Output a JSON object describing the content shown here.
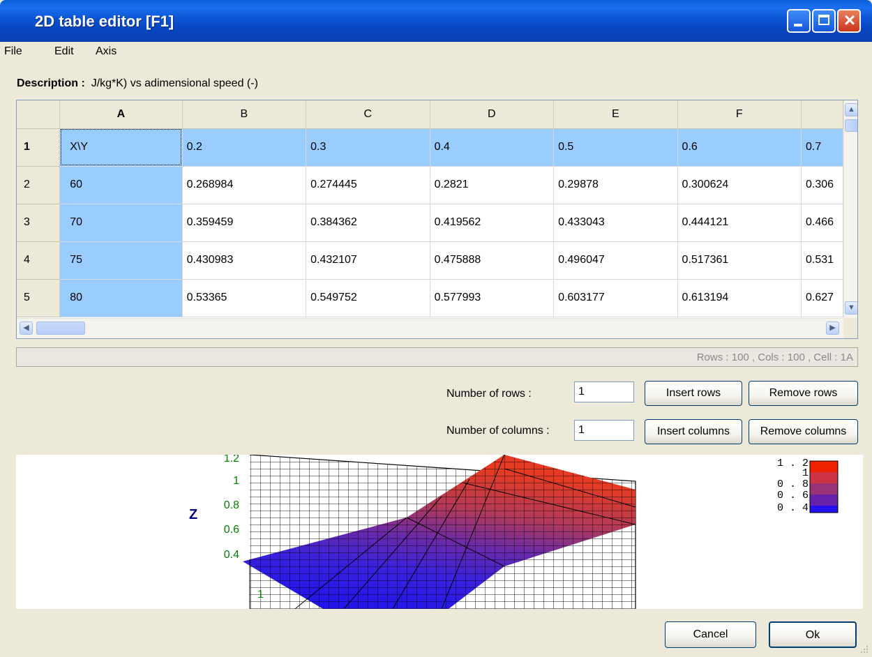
{
  "window": {
    "title": "2D table editor [F1]"
  },
  "menu": [
    "File",
    "Edit",
    "Axis"
  ],
  "description": {
    "label": "Description :",
    "text": "J/kg*K) vs adimensional speed (-)"
  },
  "grid": {
    "columns": [
      "A",
      "B",
      "C",
      "D",
      "E",
      "F",
      ""
    ],
    "rows": [
      {
        "head": "1",
        "cells": [
          "X\\Y",
          "0.2",
          "0.3",
          "0.4",
          "0.5",
          "0.6",
          "0.7"
        ]
      },
      {
        "head": "2",
        "cells": [
          "60",
          "0.268984",
          "0.274445",
          "0.2821",
          "0.29878",
          "0.300624",
          "0.306"
        ]
      },
      {
        "head": "3",
        "cells": [
          "70",
          "0.359459",
          "0.384362",
          "0.419562",
          "0.433043",
          "0.444121",
          "0.466"
        ]
      },
      {
        "head": "4",
        "cells": [
          "75",
          "0.430983",
          "0.432107",
          "0.475888",
          "0.496047",
          "0.517361",
          "0.531"
        ]
      },
      {
        "head": "5",
        "cells": [
          "80",
          "0.53365",
          "0.549752",
          "0.577993",
          "0.603177",
          "0.613194",
          "0.627"
        ]
      }
    ],
    "selected_row": 1,
    "selected_column": "A"
  },
  "status": "Rows : 100 , Cols : 100 , Cell : 1A",
  "rows_control": {
    "label": "Number of rows :",
    "value": "1",
    "insert": "Insert rows",
    "remove": "Remove rows"
  },
  "cols_control": {
    "label": "Number of columns :",
    "value": "1",
    "insert": "Insert columns",
    "remove": "Remove columns"
  },
  "plot": {
    "z_axis_label": "Z",
    "z_ticks": [
      "1.2",
      "1",
      "0.8",
      "0.6",
      "0.4"
    ],
    "x_tick": "1",
    "colorbar_ticks": [
      "1 . 2",
      "1",
      "0 . 8",
      "0 . 6",
      "0 . 4"
    ],
    "colorbar_colors": [
      "#ee2200",
      "#cc3344",
      "#993377",
      "#6622aa",
      "#2211ee"
    ],
    "tick_color": "#008000",
    "axis_label_color": "#000080"
  },
  "buttons": {
    "cancel": "Cancel",
    "ok": "Ok"
  }
}
